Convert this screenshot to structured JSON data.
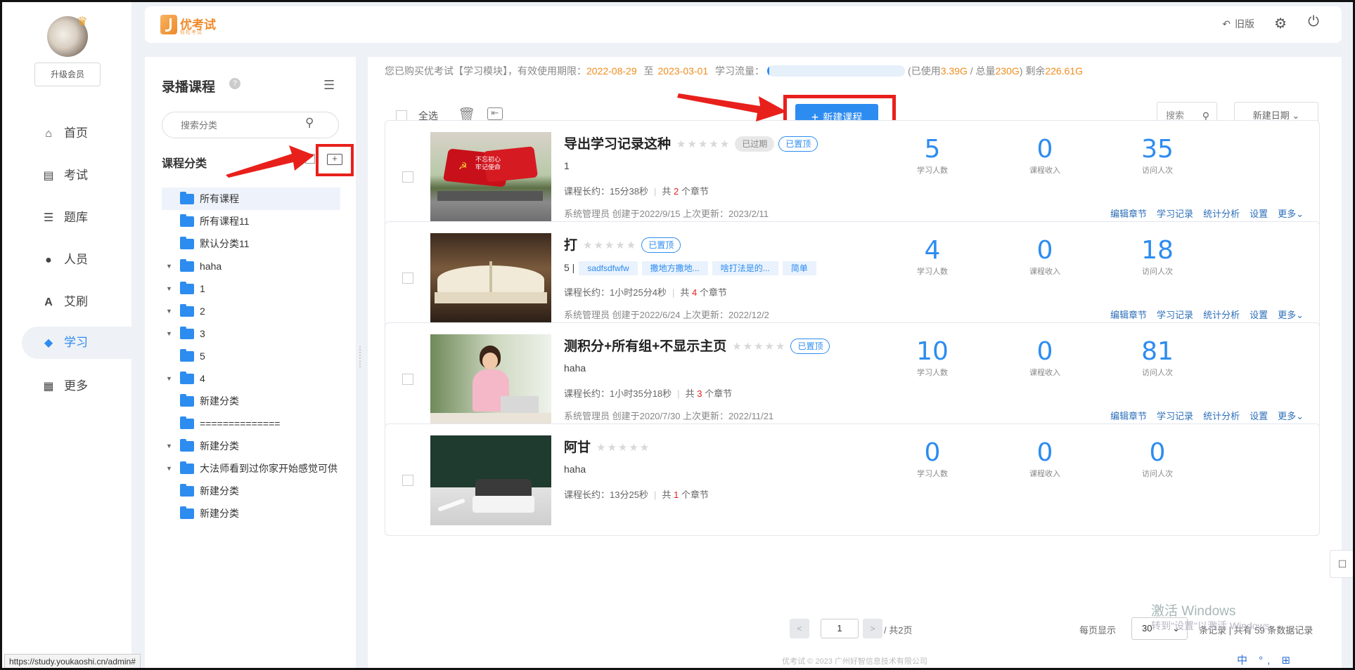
{
  "nav": {
    "upgrade_label": "升级会员",
    "items": [
      {
        "label": "首页",
        "icon": "home-icon"
      },
      {
        "label": "考试",
        "icon": "exam-icon"
      },
      {
        "label": "题库",
        "icon": "question-bank-icon"
      },
      {
        "label": "人员",
        "icon": "user-icon"
      },
      {
        "label": "艾刷",
        "icon": "brush-a-icon"
      },
      {
        "label": "学习",
        "icon": "graduation-cap-icon",
        "active": true
      },
      {
        "label": "更多",
        "icon": "grid-icon"
      }
    ]
  },
  "header": {
    "logo_name": "优考试",
    "logo_sub": "轻松考试",
    "old_version_label": "旧版"
  },
  "category_panel": {
    "title": "录播课程",
    "search_placeholder": "搜索分类",
    "subtitle": "课程分类",
    "tree": [
      {
        "label": "所有课程",
        "arrow": false,
        "selected": true
      },
      {
        "label": "所有课程11",
        "arrow": false
      },
      {
        "label": "默认分类11",
        "arrow": false
      },
      {
        "label": "haha",
        "arrow": true
      },
      {
        "label": "1",
        "arrow": true
      },
      {
        "label": "2",
        "arrow": true
      },
      {
        "label": "3",
        "arrow": true
      },
      {
        "label": "5",
        "arrow": false
      },
      {
        "label": "4",
        "arrow": true
      },
      {
        "label": "新建分类",
        "arrow": false
      },
      {
        "label": "==============",
        "arrow": false
      },
      {
        "label": "新建分类",
        "arrow": true
      },
      {
        "label": "大法师看到过你家开始感觉可供",
        "arrow": true
      },
      {
        "label": "新建分类",
        "arrow": false
      },
      {
        "label": "新建分类",
        "arrow": false
      }
    ]
  },
  "info": {
    "prefix": "您已购买优考试【学习模块】，有效使用期限：",
    "start": "2022-08-29",
    "to": "至",
    "end": "2023-03-01",
    "flow_label": "学习流量：",
    "used_prefix": "(已使用",
    "used": "3.39G",
    "total_prefix": "/ 总量",
    "total": "230G",
    "remain_prefix": ") 剩余",
    "remain": "226.61G",
    "flow_fraction": 0.015
  },
  "toolbar": {
    "select_all": "全选",
    "new_course": "新建课程",
    "search": "搜索",
    "sort": "新建日期 ⌄"
  },
  "stat_labels": {
    "learners": "学习人数",
    "income": "课程收入",
    "visits": "访问人次"
  },
  "len_label": "课程长约：",
  "actions": [
    "编辑章节",
    "学习记录",
    "统计分析",
    "设置",
    "更多⌄"
  ],
  "courses": [
    {
      "title": "导出学习记录这种",
      "tags": [
        {
          "text": "已过期",
          "style": "grey"
        },
        {
          "text": "已置顶",
          "style": "blue"
        }
      ],
      "sub": "1",
      "chips": [],
      "duration": "15分38秒",
      "chapters_prefix": "共",
      "chapters": "2",
      "chapters_suffix": "个章节",
      "meta": "系统管理员 创建于2022/9/15  上次更新：2023/2/11",
      "learners": "5",
      "income": "0",
      "visits": "35"
    },
    {
      "title": "打",
      "tags": [
        {
          "text": "已置顶",
          "style": "blue"
        }
      ],
      "sub": "5 |",
      "chips": [
        "sadfsdfwfw",
        "撒地方撒地...",
        "啥打法是的...",
        "简单"
      ],
      "duration": "1小时25分4秒",
      "chapters_prefix": "共",
      "chapters": "4",
      "chapters_suffix": "个章节",
      "meta": "系统管理员 创建于2022/6/24  上次更新：2022/12/2",
      "learners": "4",
      "income": "0",
      "visits": "18"
    },
    {
      "title": "测积分+所有组+不显示主页",
      "tags": [
        {
          "text": "已置顶",
          "style": "blue"
        }
      ],
      "sub": "haha",
      "chips": [],
      "duration": "1小时35分18秒",
      "chapters_prefix": "共",
      "chapters": "3",
      "chapters_suffix": "个章节",
      "meta": "系统管理员 创建于2020/7/30  上次更新：2022/11/21",
      "learners": "10",
      "income": "0",
      "visits": "81"
    },
    {
      "title": "阿甘",
      "tags": [],
      "sub": "haha",
      "chips": [],
      "duration": "13分25秒",
      "chapters_prefix": "共",
      "chapters": "1",
      "chapters_suffix": "个章节",
      "meta": "",
      "learners": "0",
      "income": "0",
      "visits": "0"
    }
  ],
  "pager": {
    "prev": "<",
    "current": "1",
    "next": ">",
    "total": "/ 共2页",
    "per_page_label": "每页显示",
    "per_page_value": "30",
    "tail": "条记录 | 共有 59 条数据记录"
  },
  "footer": "优考试 © 2023 广州好智信息技术有限公司",
  "watermark": {
    "line1": "激活 Windows",
    "line2": "转到\"设置\"以激活 Windows。"
  },
  "status_url": "https://study.youkaoshi.cn/admin#",
  "tray": "中 °, ⊞"
}
